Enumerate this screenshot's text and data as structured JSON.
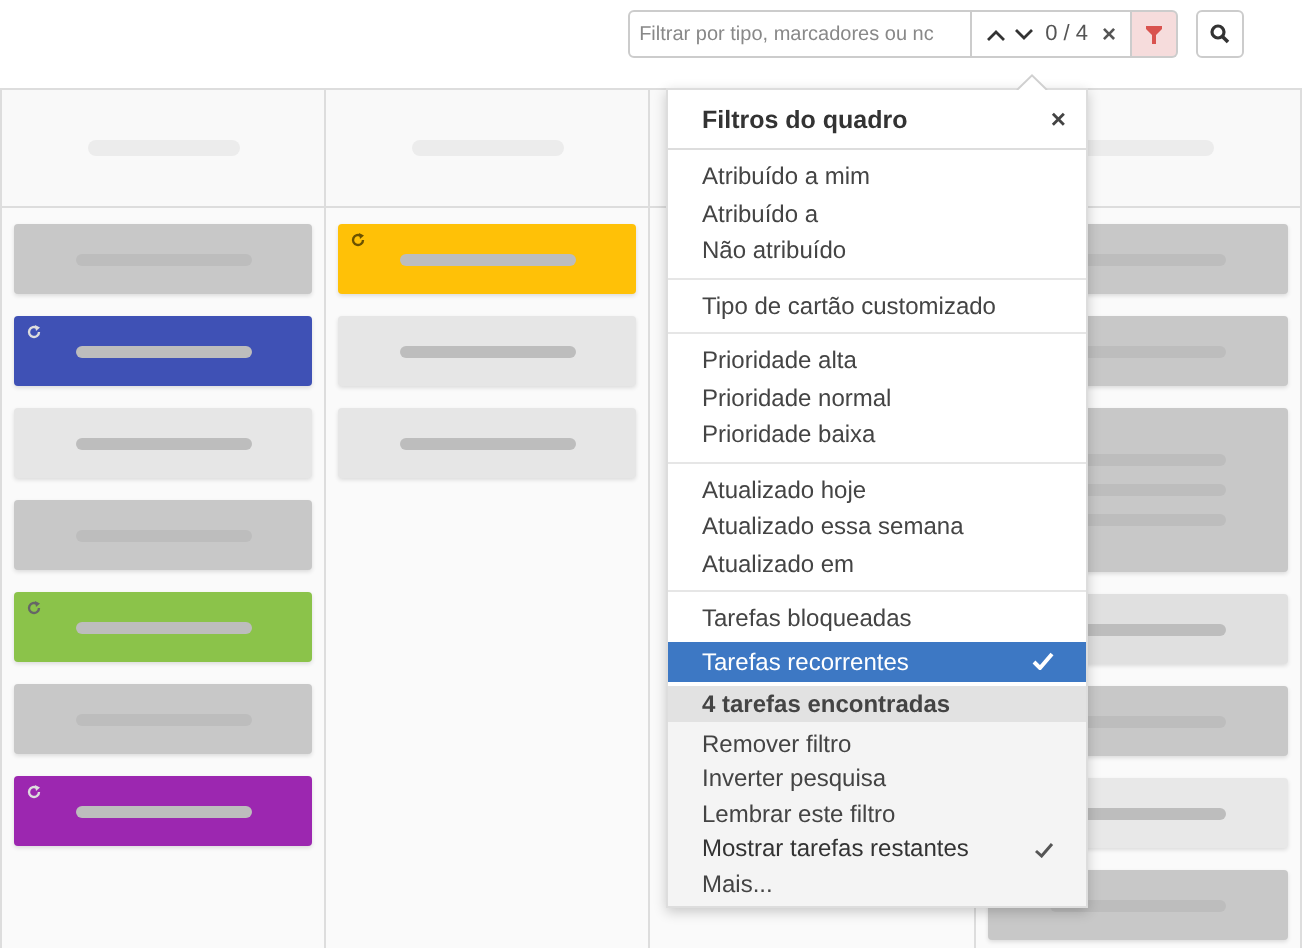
{
  "toolbar": {
    "filter_field": {
      "placeholder": "Filtrar por tipo, marcadores ou nc"
    },
    "counter": "0 / 4",
    "clear": "×",
    "filter_active": true
  },
  "board": {
    "columns": [
      {
        "cards": [
          {
            "color": "#c8c8c8",
            "recurring": false,
            "kind": "single"
          },
          {
            "color": "#3f51b5",
            "recurring": true,
            "kind": "single"
          },
          {
            "color": "#e6e6e6",
            "recurring": false,
            "kind": "single"
          },
          {
            "color": "#c8c8c8",
            "recurring": false,
            "kind": "single"
          },
          {
            "color": "#8bc34a",
            "recurring": true,
            "kind": "single"
          },
          {
            "color": "#c8c8c8",
            "recurring": false,
            "kind": "single"
          },
          {
            "color": "#9c27b0",
            "recurring": true,
            "kind": "single"
          }
        ]
      },
      {
        "cards": [
          {
            "color": "#ffc107",
            "recurring": true,
            "kind": "single"
          },
          {
            "color": "#e6e6e6",
            "recurring": false,
            "kind": "single"
          },
          {
            "color": "#e6e6e6",
            "recurring": false,
            "kind": "single"
          }
        ]
      },
      {},
      {
        "cards": [
          {
            "color": "#c8c8c8",
            "kind": "single"
          },
          {
            "color": "#c8c8c8",
            "kind": "single"
          },
          {
            "color": "#c8c8c8",
            "kind": "multi"
          },
          {
            "color": "#e0e0e0",
            "kind": "single"
          },
          {
            "color": "#c8c8c8",
            "kind": "single"
          },
          {
            "color": "#e8e8e8",
            "kind": "single"
          },
          {
            "color": "#c8c8c8",
            "kind": "single"
          }
        ]
      }
    ]
  },
  "menu": {
    "title": "Filtros do quadro",
    "close": "×",
    "groups": [
      [
        {
          "label": "Atribuído a mim",
          "selected": false
        },
        {
          "label": "Atribuído a",
          "selected": false
        },
        {
          "label": "Não atribuído",
          "selected": false
        }
      ],
      [
        {
          "label": "Tipo de cartão customizado",
          "selected": false
        }
      ],
      [
        {
          "label": "Prioridade alta",
          "selected": false
        },
        {
          "label": "Prioridade normal",
          "selected": false
        },
        {
          "label": "Prioridade baixa",
          "selected": false
        }
      ],
      [
        {
          "label": "Atualizado hoje",
          "selected": false
        },
        {
          "label": "Atualizado essa semana",
          "selected": false
        },
        {
          "label": "Atualizado em",
          "selected": false
        }
      ],
      [
        {
          "label": "Tarefas bloqueadas",
          "selected": false
        },
        {
          "label": "Tarefas recorrentes",
          "selected": true
        }
      ]
    ],
    "result_header": "4 tarefas encontradas",
    "actions": [
      {
        "label": "Remover filtro",
        "checked": false
      },
      {
        "label": "Inverter pesquisa",
        "checked": false
      },
      {
        "label": "Lembrar este filtro",
        "checked": false
      },
      {
        "label": "Mostrar tarefas restantes",
        "checked": true
      },
      {
        "label": "Mais...",
        "checked": false
      }
    ]
  }
}
